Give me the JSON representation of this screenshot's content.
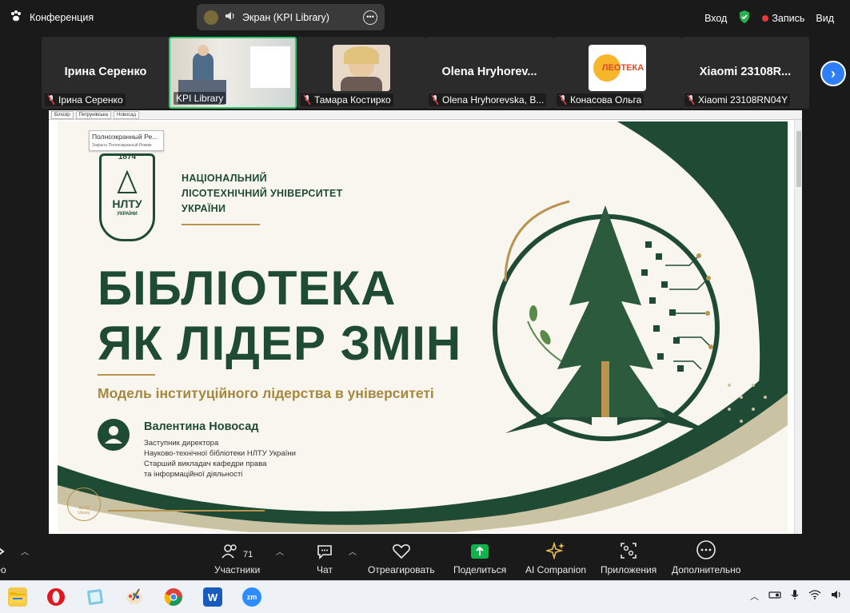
{
  "topbar": {
    "meeting_label": "Конференция",
    "share_label": "Экран (KPI Library)",
    "login_label": "Вход",
    "record_label": "Запись",
    "view_label": "Вид"
  },
  "participants": [
    {
      "big_name": "Ірина Серенко",
      "label": "Ірина Серенко",
      "type": "name"
    },
    {
      "big_name": "",
      "label": "KPI Library",
      "type": "video"
    },
    {
      "big_name": "",
      "label": "Тамара Костирко",
      "type": "photo"
    },
    {
      "big_name": "Olena  Hryhorev...",
      "label": "Olena Hryhorevska, B...",
      "type": "name"
    },
    {
      "big_name": "",
      "label": "Конасова Ольга",
      "type": "logo",
      "logo_text": "ЛЕОТЕКА"
    },
    {
      "big_name": "Xiaomi 23108R...",
      "label": "Xiaomi 23108RN04Y",
      "type": "name"
    }
  ],
  "browser": {
    "tabs": [
      "Білозір",
      "Петрунівська",
      "Новосад"
    ],
    "fullscreen_tip": "Полноэкранный Ре...",
    "fullscreen_tip_sub": "Закрыть Полноэкранный Режим"
  },
  "slide": {
    "logo_year": "1874",
    "logo_abbr": "НЛТУ",
    "logo_country": "УКРАЇНИ",
    "uni_line1": "НАЦІОНАЛЬНИЙ",
    "uni_line2": "ЛІСОТЕХНІЧНИЙ УНІВЕРСИТЕТ",
    "uni_line3": "УКРАЇНИ",
    "title_line1": "БІБЛІОТЕКА",
    "title_line2": "ЯК ЛІДЕР ЗМІН",
    "subtitle": "Модель інституційного лідерства в університеті",
    "person_name": "Валентина Новосад",
    "role_line1": "Заступник директора",
    "role_line2": "Науково-технічної бібліотеки НЛТУ України",
    "role_line3": "Старший викладач кафедри права",
    "role_line4": "та інформаційної діяльності",
    "library_badge": "NLTU Library"
  },
  "toolbar": {
    "video_label": "ео",
    "participants_label": "Участники",
    "participants_count": "71",
    "chat_label": "Чат",
    "react_label": "Отреагировать",
    "share_label": "Поделиться",
    "ai_label": "AI Companion",
    "apps_label": "Приложения",
    "more_label": "Дополнительно"
  },
  "taskbar": {
    "apps": [
      "file-explorer",
      "opera",
      "notes",
      "paint",
      "chrome",
      "word",
      "zoom"
    ],
    "zoom_text": "zm",
    "word_text": "W"
  },
  "colors": {
    "slide_green": "#1f4a34",
    "slide_gold": "#b99451",
    "active_tile_border": "#31c46b",
    "share_green": "#10b34b",
    "rec_red": "#e8383d",
    "next_blue": "#2d7ef7"
  }
}
